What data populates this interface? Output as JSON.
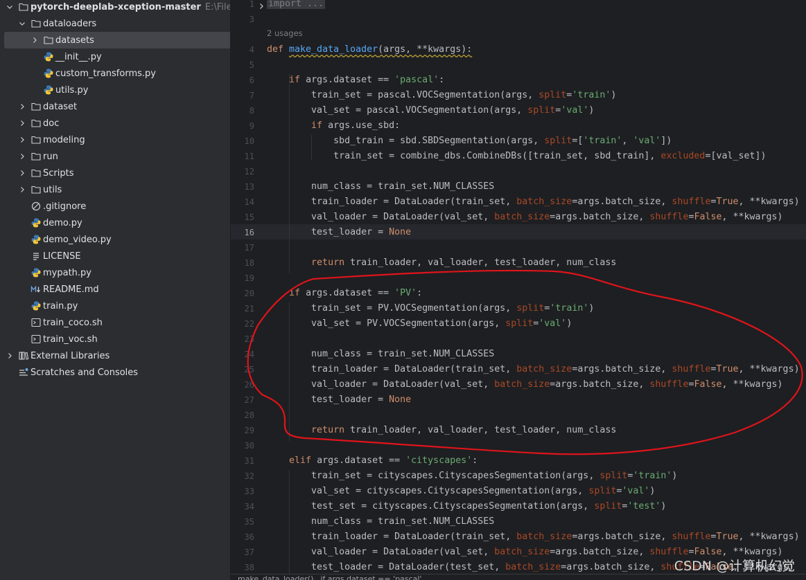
{
  "project": {
    "root_name": "pytorch-deeplab-xception-master",
    "root_path": "E:\\File\\Pych",
    "items": [
      {
        "label": "dataloaders",
        "icon": "folder-icon",
        "chevron": "down"
      },
      {
        "label": "datasets",
        "icon": "folder-icon",
        "chevron": "right",
        "selected": true
      },
      {
        "label": "__init__.py",
        "icon": "python-file-icon"
      },
      {
        "label": "custom_transforms.py",
        "icon": "python-file-icon"
      },
      {
        "label": "utils.py",
        "icon": "python-file-icon"
      },
      {
        "label": "dataset",
        "icon": "folder-icon",
        "chevron": "right"
      },
      {
        "label": "doc",
        "icon": "folder-icon",
        "chevron": "right"
      },
      {
        "label": "modeling",
        "icon": "folder-icon",
        "chevron": "right"
      },
      {
        "label": "run",
        "icon": "folder-icon",
        "chevron": "right"
      },
      {
        "label": "Scripts",
        "icon": "folder-icon",
        "chevron": "right"
      },
      {
        "label": "utils",
        "icon": "folder-icon",
        "chevron": "right"
      },
      {
        "label": ".gitignore",
        "icon": "gitignore-icon"
      },
      {
        "label": "demo.py",
        "icon": "python-file-icon"
      },
      {
        "label": "demo_video.py",
        "icon": "python-file-icon"
      },
      {
        "label": "LICENSE",
        "icon": "text-file-icon"
      },
      {
        "label": "mypath.py",
        "icon": "python-file-icon"
      },
      {
        "label": "README.md",
        "icon": "markdown-file-icon"
      },
      {
        "label": "train.py",
        "icon": "python-file-icon"
      },
      {
        "label": "train_coco.sh",
        "icon": "shell-file-icon"
      },
      {
        "label": "train_voc.sh",
        "icon": "shell-file-icon"
      },
      {
        "label": "External Libraries",
        "icon": "library-icon",
        "chevron": "right"
      },
      {
        "label": "Scratches and Consoles",
        "icon": "scratches-icon"
      }
    ]
  },
  "editor": {
    "usages_hint": "2 usages",
    "current_line": 16,
    "lines": [
      {
        "n": "1",
        "tokens": [
          {
            "t": "import ...",
            "c": "fold"
          }
        ]
      },
      {
        "n": "3",
        "tokens": []
      },
      {
        "n": "4",
        "tokens": [
          {
            "t": "def ",
            "c": "kw"
          },
          {
            "t": "make_data_loader",
            "c": "fn squig"
          },
          {
            "t": "(args, **kwargs):",
            "c": "squig"
          }
        ]
      },
      {
        "n": "5",
        "tokens": []
      },
      {
        "n": "6",
        "tokens": [
          {
            "t": "    "
          },
          {
            "t": "if ",
            "c": "kw"
          },
          {
            "t": "args.dataset == "
          },
          {
            "t": "'pascal'",
            "c": "str"
          },
          {
            "t": ":"
          }
        ]
      },
      {
        "n": "7",
        "tokens": [
          {
            "t": "        train_set = pascal.VOCSegmentation(args, "
          },
          {
            "t": "split",
            "c": "param"
          },
          {
            "t": "="
          },
          {
            "t": "'train'",
            "c": "str"
          },
          {
            "t": ")"
          }
        ]
      },
      {
        "n": "8",
        "tokens": [
          {
            "t": "        val_set = pascal.VOCSegmentation(args, "
          },
          {
            "t": "split",
            "c": "param"
          },
          {
            "t": "="
          },
          {
            "t": "'val'",
            "c": "str"
          },
          {
            "t": ")"
          }
        ]
      },
      {
        "n": "9",
        "tokens": [
          {
            "t": "        "
          },
          {
            "t": "if ",
            "c": "kw"
          },
          {
            "t": "args.use_sbd:"
          }
        ]
      },
      {
        "n": "10",
        "tokens": [
          {
            "t": "            sbd_train = sbd.SBDSegmentation(args, "
          },
          {
            "t": "split",
            "c": "param"
          },
          {
            "t": "=["
          },
          {
            "t": "'train'",
            "c": "str"
          },
          {
            "t": ", "
          },
          {
            "t": "'val'",
            "c": "str"
          },
          {
            "t": "])"
          }
        ]
      },
      {
        "n": "11",
        "tokens": [
          {
            "t": "            train_set = combine_dbs.CombineDBs([train_set, sbd_train], "
          },
          {
            "t": "excluded",
            "c": "param"
          },
          {
            "t": "=[val_set])"
          }
        ]
      },
      {
        "n": "12",
        "tokens": []
      },
      {
        "n": "13",
        "tokens": [
          {
            "t": "        num_class = train_set.NUM_CLASSES"
          }
        ]
      },
      {
        "n": "14",
        "tokens": [
          {
            "t": "        train_loader = DataLoader(train_set, "
          },
          {
            "t": "batch_size",
            "c": "param"
          },
          {
            "t": "=args.batch_size, "
          },
          {
            "t": "shuffle",
            "c": "param"
          },
          {
            "t": "="
          },
          {
            "t": "True",
            "c": "kw"
          },
          {
            "t": ", **kwargs)"
          }
        ]
      },
      {
        "n": "15",
        "tokens": [
          {
            "t": "        val_loader = DataLoader(val_set, "
          },
          {
            "t": "batch_size",
            "c": "param"
          },
          {
            "t": "=args.batch_size, "
          },
          {
            "t": "shuffle",
            "c": "param"
          },
          {
            "t": "="
          },
          {
            "t": "False",
            "c": "kw"
          },
          {
            "t": ", **kwargs)"
          }
        ]
      },
      {
        "n": "16",
        "tokens": [
          {
            "t": "        test_loader = "
          },
          {
            "t": "None",
            "c": "kw"
          }
        ]
      },
      {
        "n": "17",
        "tokens": []
      },
      {
        "n": "18",
        "tokens": [
          {
            "t": "        "
          },
          {
            "t": "return ",
            "c": "kw"
          },
          {
            "t": "train_loader, val_loader, test_loader, num_class"
          }
        ]
      },
      {
        "n": "19",
        "tokens": []
      },
      {
        "n": "20",
        "tokens": [
          {
            "t": "    "
          },
          {
            "t": "if ",
            "c": "kw"
          },
          {
            "t": "args.dataset == "
          },
          {
            "t": "'PV'",
            "c": "str"
          },
          {
            "t": ":"
          }
        ]
      },
      {
        "n": "21",
        "tokens": [
          {
            "t": "        train_set = PV.VOCSegmentation(args, "
          },
          {
            "t": "split",
            "c": "param"
          },
          {
            "t": "="
          },
          {
            "t": "'train'",
            "c": "str"
          },
          {
            "t": ")"
          }
        ]
      },
      {
        "n": "22",
        "tokens": [
          {
            "t": "        val_set = PV.VOCSegmentation(args, "
          },
          {
            "t": "split",
            "c": "param"
          },
          {
            "t": "="
          },
          {
            "t": "'val'",
            "c": "str"
          },
          {
            "t": ")"
          }
        ]
      },
      {
        "n": "23",
        "tokens": []
      },
      {
        "n": "24",
        "tokens": [
          {
            "t": "        num_class = train_set.NUM_CLASSES"
          }
        ]
      },
      {
        "n": "25",
        "tokens": [
          {
            "t": "        train_loader = DataLoader(train_set, "
          },
          {
            "t": "batch_size",
            "c": "param"
          },
          {
            "t": "=args.batch_size, "
          },
          {
            "t": "shuffle",
            "c": "param"
          },
          {
            "t": "="
          },
          {
            "t": "True",
            "c": "kw"
          },
          {
            "t": ", **kwargs)"
          }
        ]
      },
      {
        "n": "26",
        "tokens": [
          {
            "t": "        val_loader = DataLoader(val_set, "
          },
          {
            "t": "batch_size",
            "c": "param"
          },
          {
            "t": "=args.batch_size, "
          },
          {
            "t": "shuffle",
            "c": "param"
          },
          {
            "t": "="
          },
          {
            "t": "False",
            "c": "kw"
          },
          {
            "t": ", **kwargs)"
          }
        ]
      },
      {
        "n": "27",
        "tokens": [
          {
            "t": "        test_loader = "
          },
          {
            "t": "None",
            "c": "kw"
          }
        ]
      },
      {
        "n": "28",
        "tokens": []
      },
      {
        "n": "29",
        "tokens": [
          {
            "t": "        "
          },
          {
            "t": "return ",
            "c": "kw"
          },
          {
            "t": "train_loader, val_loader, test_loader, num_class"
          }
        ]
      },
      {
        "n": "30",
        "tokens": []
      },
      {
        "n": "31",
        "tokens": [
          {
            "t": "    "
          },
          {
            "t": "elif ",
            "c": "kw"
          },
          {
            "t": "args.dataset == "
          },
          {
            "t": "'cityscapes'",
            "c": "str"
          },
          {
            "t": ":"
          }
        ]
      },
      {
        "n": "32",
        "tokens": [
          {
            "t": "        train_set = cityscapes.CityscapesSegmentation(args, "
          },
          {
            "t": "split",
            "c": "param"
          },
          {
            "t": "="
          },
          {
            "t": "'train'",
            "c": "str"
          },
          {
            "t": ")"
          }
        ]
      },
      {
        "n": "33",
        "tokens": [
          {
            "t": "        val_set = cityscapes.CityscapesSegmentation(args, "
          },
          {
            "t": "split",
            "c": "param"
          },
          {
            "t": "="
          },
          {
            "t": "'val'",
            "c": "str"
          },
          {
            "t": ")"
          }
        ]
      },
      {
        "n": "34",
        "tokens": [
          {
            "t": "        test_set = cityscapes.CityscapesSegmentation(args, "
          },
          {
            "t": "split",
            "c": "param"
          },
          {
            "t": "="
          },
          {
            "t": "'test'",
            "c": "str"
          },
          {
            "t": ")"
          }
        ]
      },
      {
        "n": "35",
        "tokens": [
          {
            "t": "        num_class = train_set.NUM_CLASSES"
          }
        ]
      },
      {
        "n": "36",
        "tokens": [
          {
            "t": "        train_loader = DataLoader(train_set, "
          },
          {
            "t": "batch_size",
            "c": "param"
          },
          {
            "t": "=args.batch_size, "
          },
          {
            "t": "shuffle",
            "c": "param"
          },
          {
            "t": "="
          },
          {
            "t": "True",
            "c": "kw"
          },
          {
            "t": ", **kwargs)"
          }
        ]
      },
      {
        "n": "37",
        "tokens": [
          {
            "t": "        val_loader = DataLoader(val_set, "
          },
          {
            "t": "batch_size",
            "c": "param"
          },
          {
            "t": "=args.batch_size, "
          },
          {
            "t": "shuffle",
            "c": "param"
          },
          {
            "t": "="
          },
          {
            "t": "False",
            "c": "kw"
          },
          {
            "t": ", **kwargs)"
          }
        ]
      },
      {
        "n": "38",
        "tokens": [
          {
            "t": "        test_loader = DataLoader(test_set, "
          },
          {
            "t": "batch_size",
            "c": "param"
          },
          {
            "t": "=args.batch_size, "
          },
          {
            "t": "shuffle",
            "c": "param"
          },
          {
            "t": "="
          },
          {
            "t": "False",
            "c": "kw"
          },
          {
            "t": ", **kwargs)"
          }
        ]
      }
    ]
  },
  "breadcrumb": {
    "items": [
      "make_data_loader()",
      "if args.dataset == 'pascal'"
    ]
  },
  "watermark": "CSDN @计算机幻觉",
  "colors": {
    "annotation": "#e0141b",
    "accent": "#3574f0"
  }
}
